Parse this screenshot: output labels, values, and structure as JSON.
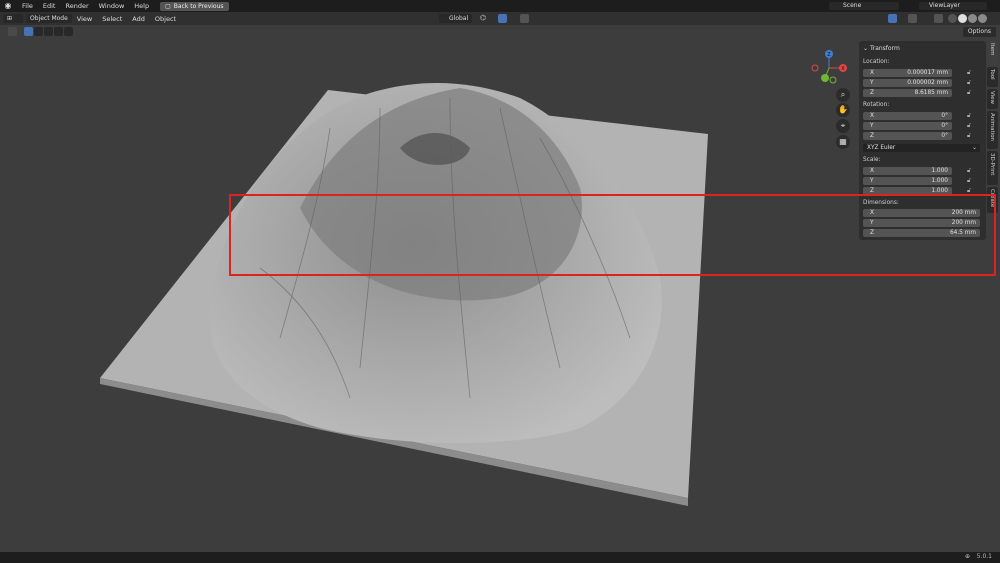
{
  "topbar": {
    "menus": [
      "File",
      "Edit",
      "Render",
      "Window",
      "Help"
    ],
    "back_button": "Back to Previous",
    "scene": "Scene",
    "view_layer": "ViewLayer"
  },
  "header": {
    "mode": "Object Mode",
    "menus": [
      "View",
      "Select",
      "Add",
      "Object"
    ],
    "transform_orientation": "Global",
    "options": "Options"
  },
  "sidebar_tabs": [
    "Item",
    "Tool",
    "View",
    "Animation",
    "3D-Print",
    "Create"
  ],
  "transform": {
    "title": "Transform",
    "location_label": "Location:",
    "location": [
      {
        "axis": "X",
        "value": "0.000017 mm"
      },
      {
        "axis": "Y",
        "value": "0.000002 mm"
      },
      {
        "axis": "Z",
        "value": "8.6185 mm"
      }
    ],
    "rotation_label": "Rotation:",
    "rotation": [
      {
        "axis": "X",
        "value": "0°"
      },
      {
        "axis": "Y",
        "value": "0°"
      },
      {
        "axis": "Z",
        "value": "0°"
      }
    ],
    "rotation_mode": "XYZ Euler",
    "scale_label": "Scale:",
    "scale": [
      {
        "axis": "X",
        "value": "1.000"
      },
      {
        "axis": "Y",
        "value": "1.000"
      },
      {
        "axis": "Z",
        "value": "1.000"
      }
    ],
    "dimensions_label": "Dimensions:",
    "dimensions": [
      {
        "axis": "X",
        "value": "200 mm"
      },
      {
        "axis": "Y",
        "value": "200 mm"
      },
      {
        "axis": "Z",
        "value": "64.5 mm"
      }
    ]
  },
  "gizmo": {
    "x": "X",
    "y": "Y",
    "z": "Z"
  },
  "status": {
    "version": "5.0.1"
  },
  "colors": {
    "highlight": "#dd2222",
    "panel": "#2e2e2e",
    "field": "#545454"
  }
}
